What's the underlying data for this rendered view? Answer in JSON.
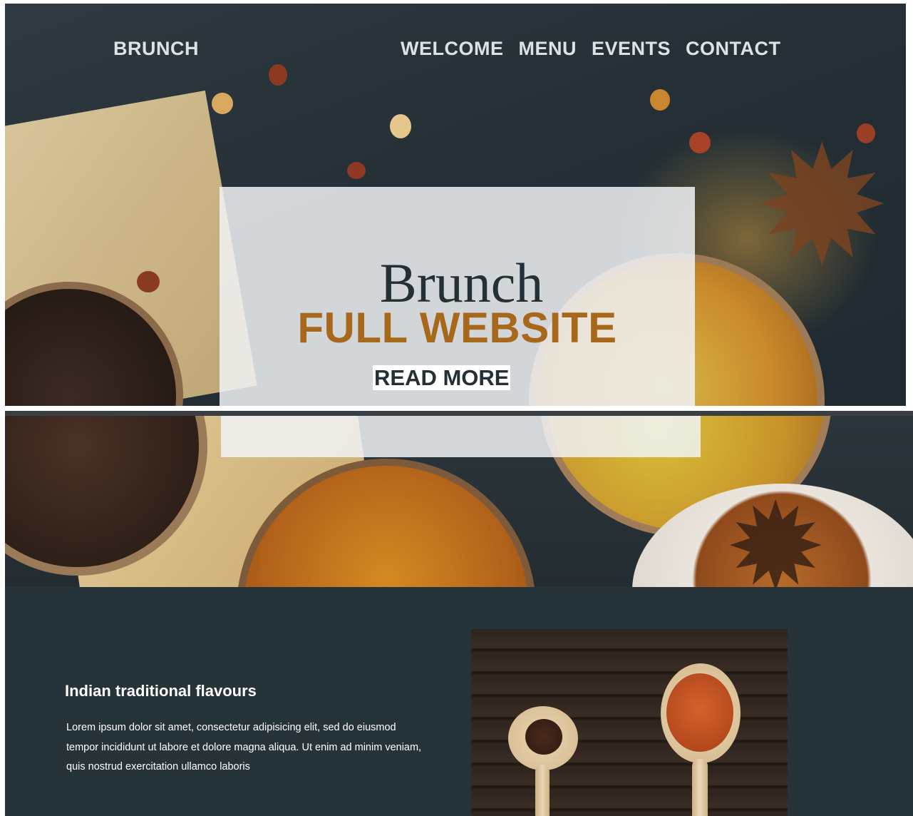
{
  "nav": {
    "brand": "BRUNCH",
    "links": [
      "WELCOME",
      "MENU",
      "EVENTS",
      "CONTACT"
    ]
  },
  "hero": {
    "title": "Brunch",
    "subtitle": "FULL WEBSITE",
    "button": "READ MORE"
  },
  "feature": {
    "heading": "Indian traditional flavours",
    "body": "Lorem ipsum dolor sit amet, consectetur adipisicing elit, sed do eiusmod tempor incididunt ut labore et dolore magna aliqua. Ut enim ad minim veniam, quis nostrud exercitation ullamco laboris"
  },
  "colors": {
    "accent": "#a8681c",
    "dark": "#243036",
    "section_bg": "#263439",
    "nav_text": "#dde2e4"
  }
}
